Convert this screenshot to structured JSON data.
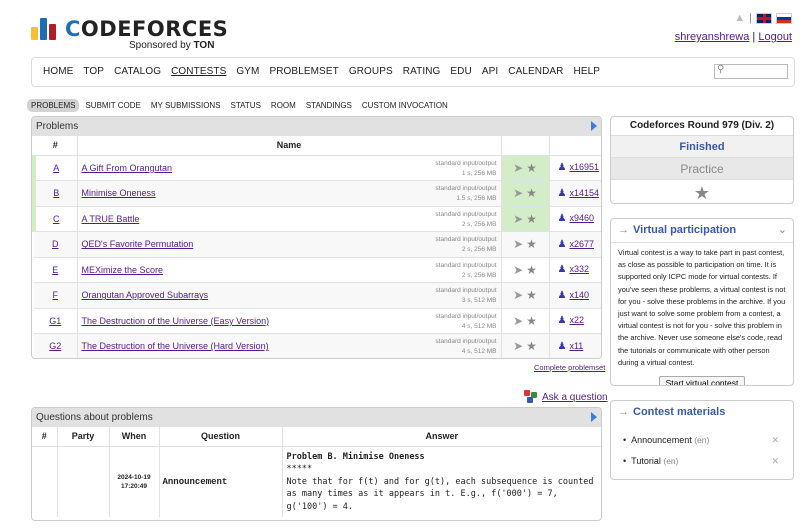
{
  "brand": {
    "logo_text": "CODEFORCES",
    "sponsor_prefix": "Sponsored by",
    "sponsor_name": "TON"
  },
  "header": {
    "separator": "|",
    "username": "shreyanshrewa",
    "logout": "Logout"
  },
  "nav": {
    "items": [
      "HOME",
      "TOP",
      "CATALOG",
      "CONTESTS",
      "GYM",
      "PROBLEMSET",
      "GROUPS",
      "RATING",
      "EDU",
      "API",
      "CALENDAR",
      "HELP"
    ],
    "active": "CONTESTS"
  },
  "subtabs": [
    "PROBLEMS",
    "SUBMIT CODE",
    "MY SUBMISSIONS",
    "STATUS",
    "ROOM",
    "STANDINGS",
    "CUSTOM INVOCATION"
  ],
  "problems": {
    "title": "Problems",
    "col_index": "#",
    "col_name": "Name",
    "rows": [
      {
        "idx": "A",
        "name": "A Gift From Orangutan",
        "io": "standard input/output",
        "limits": "1 s, 256 MB",
        "solved": "x16951",
        "accepted": true
      },
      {
        "idx": "B",
        "name": "Minimise Oneness",
        "io": "standard input/output",
        "limits": "1.5 s, 256 MB",
        "solved": "x14154",
        "accepted": true
      },
      {
        "idx": "C",
        "name": "A TRUE Battle",
        "io": "standard input/output",
        "limits": "2 s, 256 MB",
        "solved": "x9460",
        "accepted": true
      },
      {
        "idx": "D",
        "name": "QED's Favorite Permutation",
        "io": "standard input/output",
        "limits": "2 s, 256 MB",
        "solved": "x2677",
        "accepted": false
      },
      {
        "idx": "E",
        "name": "MEXimize the Score",
        "io": "standard input/output",
        "limits": "2 s, 256 MB",
        "solved": "x332",
        "accepted": false
      },
      {
        "idx": "F",
        "name": "Orangutan Approved Subarrays",
        "io": "standard input/output",
        "limits": "3 s, 512 MB",
        "solved": "x140",
        "accepted": false
      },
      {
        "idx": "G1",
        "name": "The Destruction of the Universe (Easy Version)",
        "io": "standard input/output",
        "limits": "4 s, 512 MB",
        "solved": "x22",
        "accepted": false
      },
      {
        "idx": "G2",
        "name": "The Destruction of the Universe (Hard Version)",
        "io": "standard input/output",
        "limits": "4 s, 512 MB",
        "solved": "x11",
        "accepted": false
      }
    ],
    "complete_link": "Complete problemset",
    "ask_link": "Ask a question"
  },
  "questions": {
    "title": "Questions about problems",
    "headers": [
      "#",
      "Party",
      "When",
      "Question",
      "Answer"
    ],
    "row": {
      "date": "2024-10-19",
      "time": "17:20:49",
      "question": "Announcement",
      "answer_title": "Problem B. Minimise Oneness",
      "answer_stars": "*****",
      "answer_body": "Note that for f(t) and for g(t), each subsequence is counted as many times as it appears in t. E.g., f('000') = 7, g('100') = 4."
    }
  },
  "sidebar": {
    "round_title": "Codeforces Round 979 (Div. 2)",
    "status": "Finished",
    "practice": "Practice",
    "virtual": {
      "title": "Virtual participation",
      "arrow": "→",
      "text": "Virtual contest is a way to take part in past contest, as close as possible to participation on time. It is supported only ICPC mode for virtual contests. If you've seen these problems, a virtual contest is not for you - solve these problems in the archive. If you just want to solve some problem from a contest, a virtual contest is not for you - solve this problem in the archive. Never use someone else's code, read the tutorials or communicate with other person during a virtual contest.",
      "button": "Start virtual contest"
    },
    "materials": {
      "title": "Contest materials",
      "arrow": "→",
      "items": [
        {
          "name": "Announcement",
          "lang": "(en)"
        },
        {
          "name": "Tutorial",
          "lang": "(en)"
        }
      ]
    }
  },
  "colors": {
    "accepted_bg": "#d4edc9",
    "link": "#551a8b",
    "accent_blue": "#3a58a8"
  }
}
